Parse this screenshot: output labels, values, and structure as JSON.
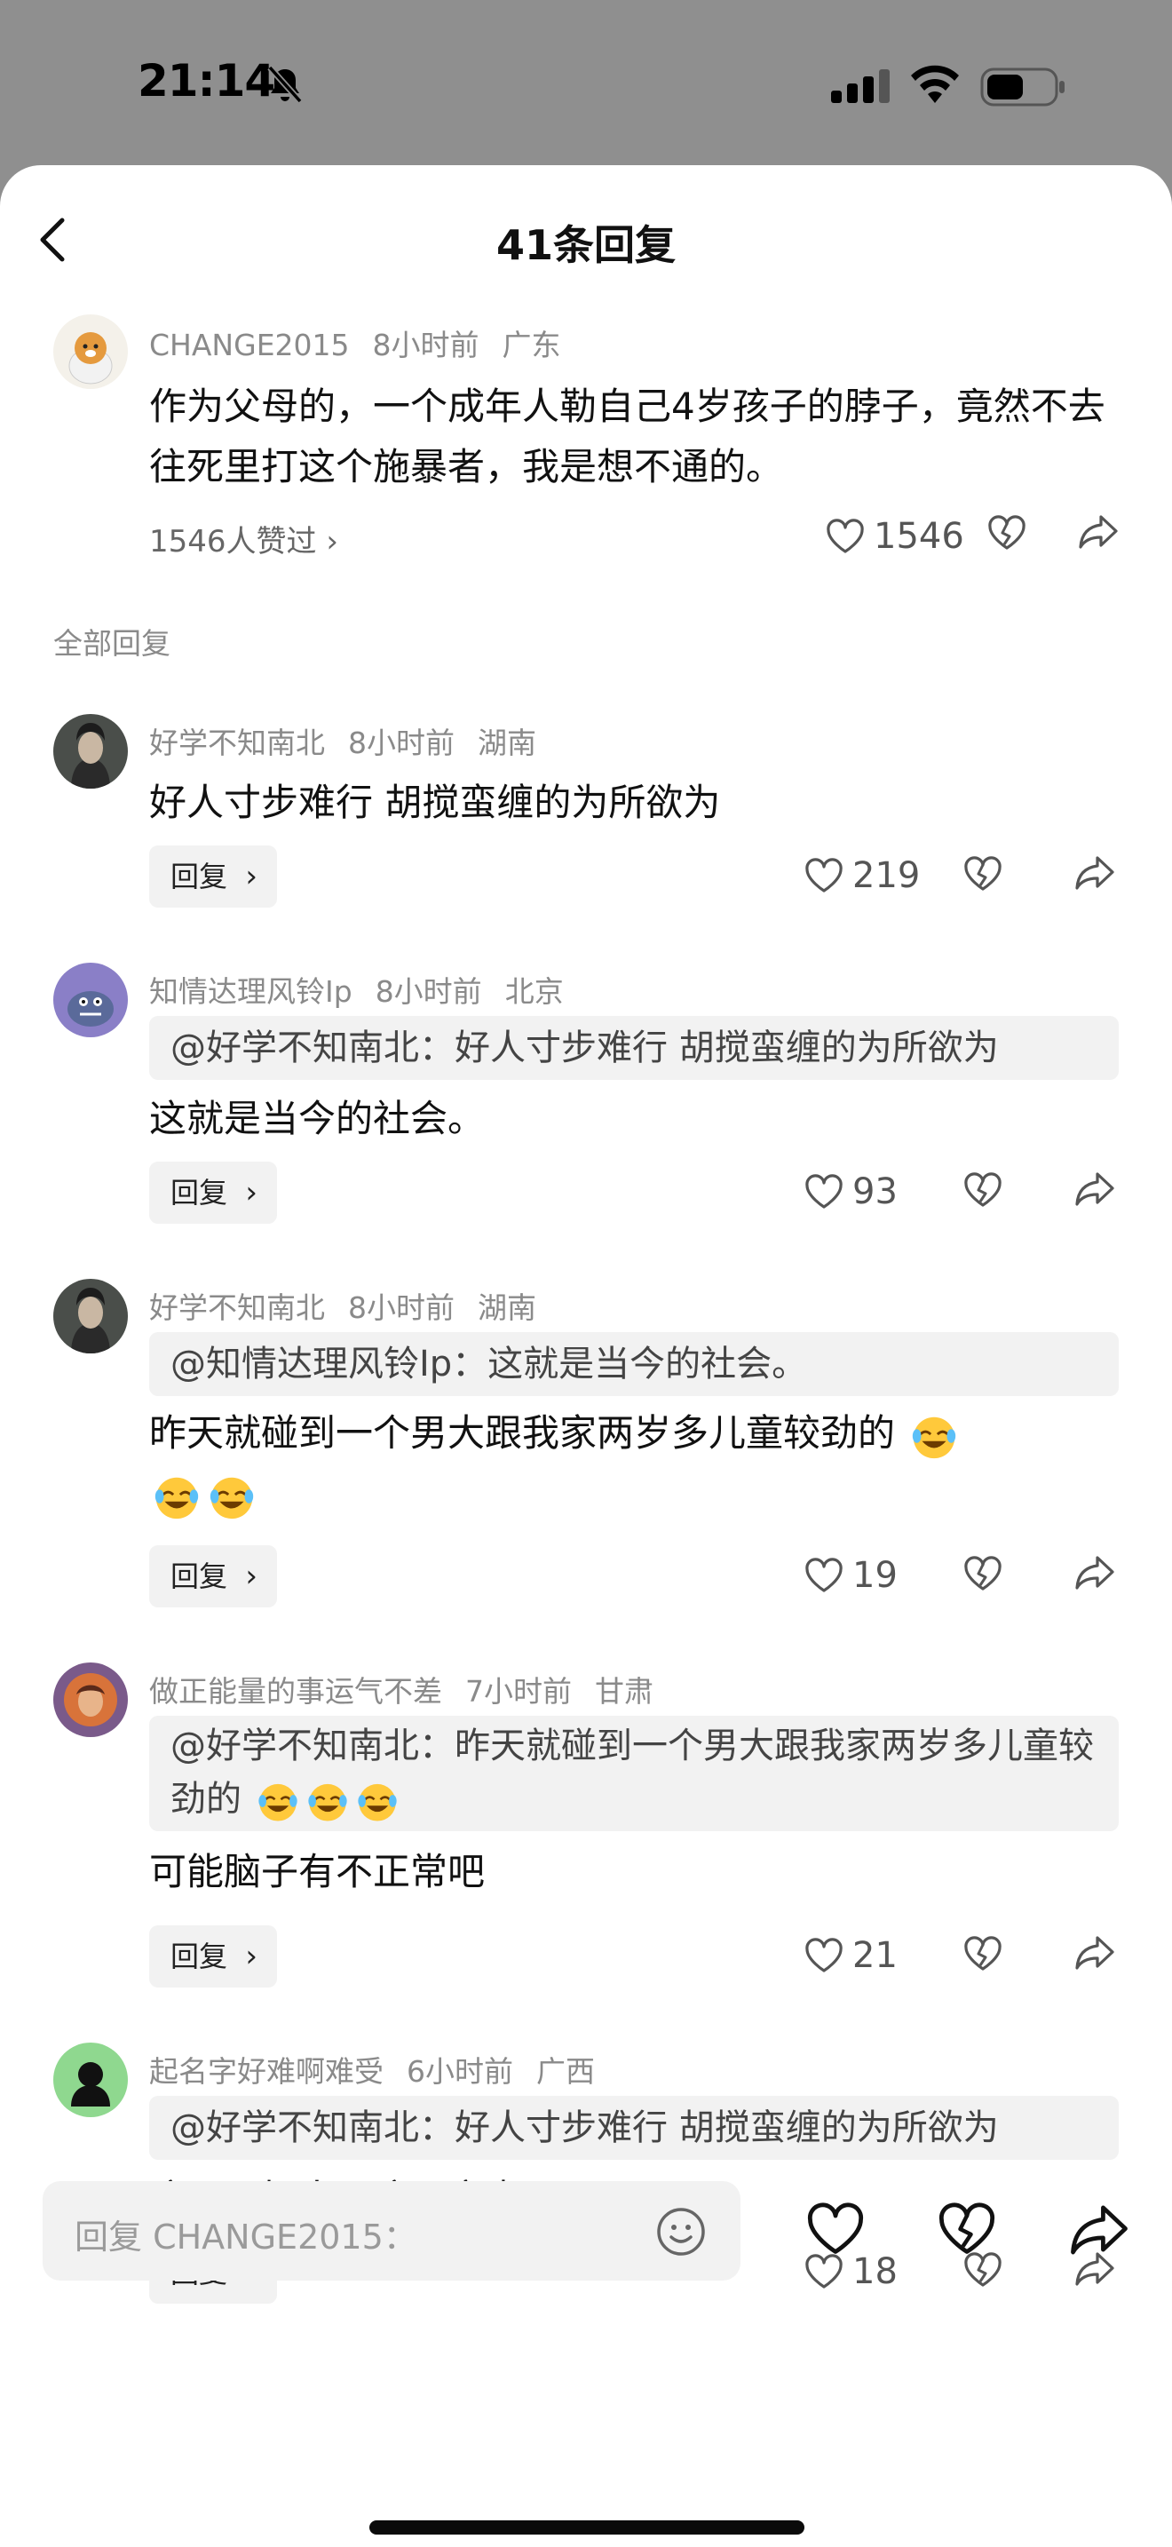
{
  "status_bar": {
    "time": "21:14"
  },
  "header": {
    "title": "41条回复"
  },
  "main_comment": {
    "user": "CHANGE2015",
    "time": "8小时前",
    "location": "广东",
    "text": "作为父母的，一个成年人勒自己4岁孩子的脖子，竟然不去往死里打这个施暴者，我是想不通的。",
    "likers": "1546人赞过",
    "likes": "1546"
  },
  "section_label": "全部回复",
  "replies": [
    {
      "user": "好学不知南北",
      "time": "8小时前",
      "location": "湖南",
      "quote": "",
      "text": "好人寸步难行 胡搅蛮缠的为所欲为",
      "reply_label": "回复",
      "likes": "219"
    },
    {
      "user": "知情达理风铃Ip",
      "time": "8小时前",
      "location": "北京",
      "quote": "@好学不知南北：好人寸步难行 胡搅蛮缠的为所欲为",
      "text": "这就是当今的社会。",
      "reply_label": "回复",
      "likes": "93"
    },
    {
      "user": "好学不知南北",
      "time": "8小时前",
      "location": "湖南",
      "quote": "@知情达理风铃Ip：这就是当今的社会。",
      "text": "昨天就碰到一个男大跟我家两岁多儿童较劲的",
      "reply_label": "回复",
      "likes": "19"
    },
    {
      "user": "做正能量的事运气不差",
      "time": "7小时前",
      "location": "甘肃",
      "quote": "@好学不知南北：昨天就碰到一个男大跟我家两岁多儿童较劲的",
      "text": "可能脑子有不正常吧",
      "reply_label": "回复",
      "likes": "21"
    },
    {
      "user": "起名字好难啊难受",
      "time": "6小时前",
      "location": "广西",
      "quote": "@好学不知南北：好人寸步难行 胡搅蛮缠的为所欲为",
      "text": "这不是好人，这是窝囊",
      "reply_label": "回复",
      "likes": "18"
    }
  ],
  "bottom_bar": {
    "placeholder": "回复 CHANGE2015："
  },
  "icons": {
    "like": "heart-outline-icon",
    "dislike": "broken-heart-icon",
    "share": "share-arrow-icon",
    "emoji": "smile-icon",
    "laugh": "laughing-crying-emoji"
  }
}
